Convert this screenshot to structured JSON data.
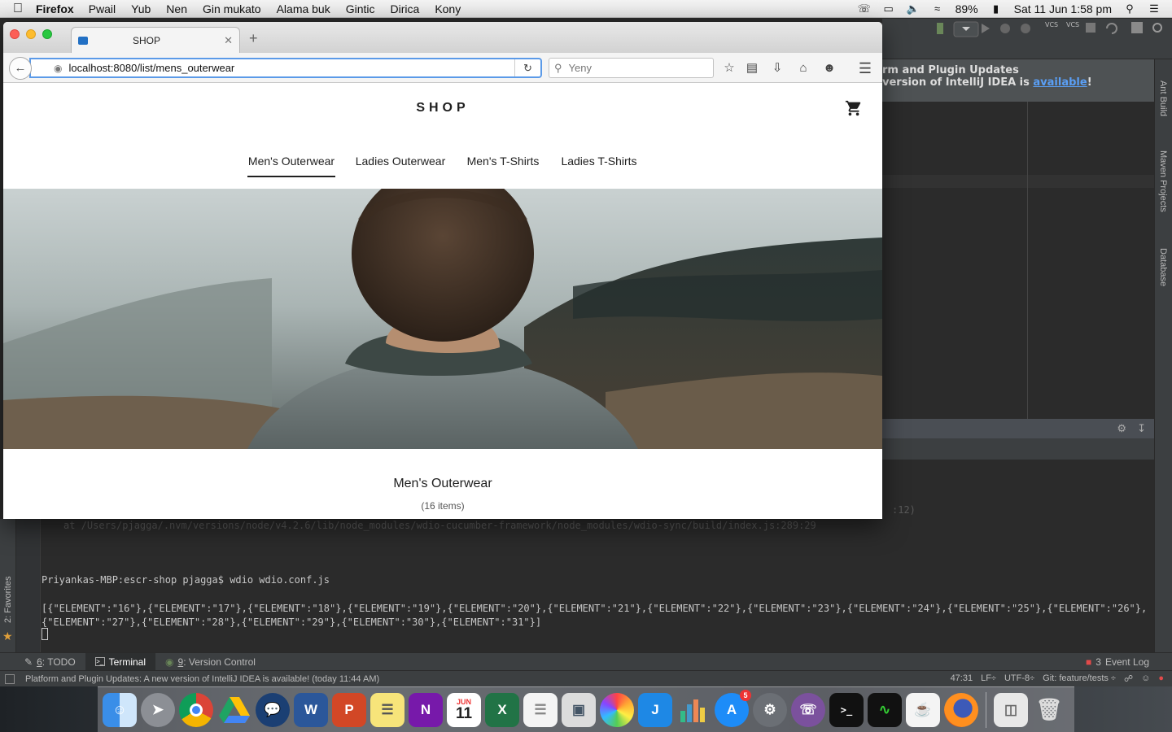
{
  "menubar": {
    "app_name": "Firefox",
    "items": [
      "Pwail",
      "Yub",
      "Nen",
      "Gin mukato",
      "Alama buk",
      "Gintic",
      "Dirica",
      "Kony"
    ],
    "battery": "89%",
    "datetime": "Sat 11 Jun  1:58 pm"
  },
  "browser": {
    "tab_title": "SHOP",
    "url": "localhost:8080/list/mens_outerwear",
    "search_placeholder": "Yeny"
  },
  "page": {
    "shop_title": "SHOP",
    "tabs": [
      {
        "label": "Men's Outerwear",
        "active": true
      },
      {
        "label": "Ladies Outerwear",
        "active": false
      },
      {
        "label": "Men's T-Shirts",
        "active": false
      },
      {
        "label": "Ladies T-Shirts",
        "active": false
      }
    ],
    "list_title": "Men's Outerwear",
    "item_count": "(16 items)"
  },
  "ide": {
    "notification_line1": "rm and Plugin Updates",
    "notification_line2": " version of IntelliJ IDEA is ",
    "notification_link": "available",
    "notification_end": "!",
    "side_tabs": [
      "Ant Build",
      "Maven Projects",
      "Database"
    ],
    "left_tab": "2: Favorites",
    "trace_line": "at /Users/pjagga/.nvm/versions/node/v4.2.6/lib/node_modules/wdio-cucumber-framework/node_modules/wdio-sync/build/index.js:289:29",
    "trace_tail": ":12)",
    "prompt": "Priyankas-MBP:escr-shop pjagga$ wdio wdio.conf.js",
    "output": "[{\"ELEMENT\":\"16\"},{\"ELEMENT\":\"17\"},{\"ELEMENT\":\"18\"},{\"ELEMENT\":\"19\"},{\"ELEMENT\":\"20\"},{\"ELEMENT\":\"21\"},{\"ELEMENT\":\"22\"},{\"ELEMENT\":\"23\"},{\"ELEMENT\":\"24\"},{\"ELEMENT\":\"25\"},{\"ELEMENT\":\"26\"},{\"ELEMENT\":\"27\"},{\"ELEMENT\":\"28\"},{\"ELEMENT\":\"29\"},{\"ELEMENT\":\"30\"},{\"ELEMENT\":\"31\"}]",
    "toolwindows": {
      "todo": "TODO",
      "todo_num": "6",
      "terminal": "Terminal",
      "vcs": "Version Control",
      "vcs_num": "9",
      "event_log": "Event Log",
      "event_num": "3"
    },
    "status_message": "Platform and Plugin Updates: A new version of IntelliJ IDEA is available! (today 11:44 AM)",
    "status_position": "47:31",
    "status_lf": "LF÷",
    "status_encoding": "UTF-8÷",
    "status_git": "Git: feature/tests ÷"
  },
  "dock": {
    "calendar_month": "JUN",
    "calendar_day": "11",
    "appstore_badge": "5"
  },
  "colors": {
    "accent_blue": "#5b9ae8",
    "ide_background": "#2b2b2b",
    "link_blue": "#5a9ff5"
  }
}
